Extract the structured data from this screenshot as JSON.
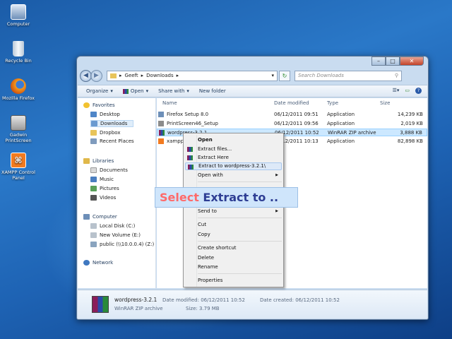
{
  "desktop": {
    "icons": [
      {
        "label": "Computer",
        "icon": "computer-icon"
      },
      {
        "label": "Recycle Bin",
        "icon": "recycle-bin-icon"
      },
      {
        "label": "Mozilla Firefox",
        "icon": "firefox-icon"
      },
      {
        "label": "Gadwin PrintScreen",
        "icon": "printscreen-icon"
      },
      {
        "label": "XAMPP Control Panel",
        "icon": "xampp-icon"
      }
    ]
  },
  "window": {
    "buttons": {
      "minimize": "–",
      "maximize": "□",
      "close": "✕"
    },
    "breadcrumb": [
      "Geeft",
      "Downloads"
    ],
    "search_placeholder": "Search Downloads",
    "toolbar": {
      "organize": "Organize",
      "open": "Open",
      "share": "Share with",
      "new_folder": "New folder"
    },
    "nav": {
      "favorites_head": "Favorites",
      "favorites": [
        "Desktop",
        "Downloads",
        "Dropbox",
        "Recent Places"
      ],
      "libraries_head": "Libraries",
      "libraries": [
        "Documents",
        "Music",
        "Pictures",
        "Videos"
      ],
      "computer_head": "Computer",
      "computer": [
        "Local Disk (C:)",
        "New Volume (E:)",
        "public (\\\\10.0.0.4) (Z:)"
      ],
      "network": "Network"
    },
    "columns": {
      "name": "Name",
      "date": "Date modified",
      "type": "Type",
      "size": "Size"
    },
    "files": [
      {
        "name": "Firefox Setup 8.0",
        "date": "06/12/2011 09:51",
        "type": "Application",
        "size": "14,239 KB"
      },
      {
        "name": "PrintScreen46_Setup",
        "date": "06/12/2011 09:56",
        "type": "Application",
        "size": "2,019 KB"
      },
      {
        "name": "wordpress-3.2.1",
        "date": "06/12/2011 10:52",
        "type": "WinRAR ZIP archive",
        "size": "3,888 KB"
      },
      {
        "name": "xampp",
        "date": "06/12/2011 10:13",
        "type": "Application",
        "size": "82,898 KB"
      }
    ],
    "status": {
      "filename": "wordpress-3.2.1",
      "date_label": "Date modified: 06/12/2011 10:52",
      "created_label": "Date created: 06/12/2011 10:52",
      "type": "WinRAR ZIP archive",
      "size": "Size: 3.79 MB"
    }
  },
  "context_menu": {
    "items": [
      "Open",
      "Extract files...",
      "Extract Here",
      "Extract to wordpress-3.2.1\\",
      "Open with",
      "Send to",
      "Cut",
      "Copy",
      "Create shortcut",
      "Delete",
      "Rename",
      "Properties"
    ]
  },
  "caption": {
    "part1": "Select",
    "part2": " Extract to .."
  }
}
